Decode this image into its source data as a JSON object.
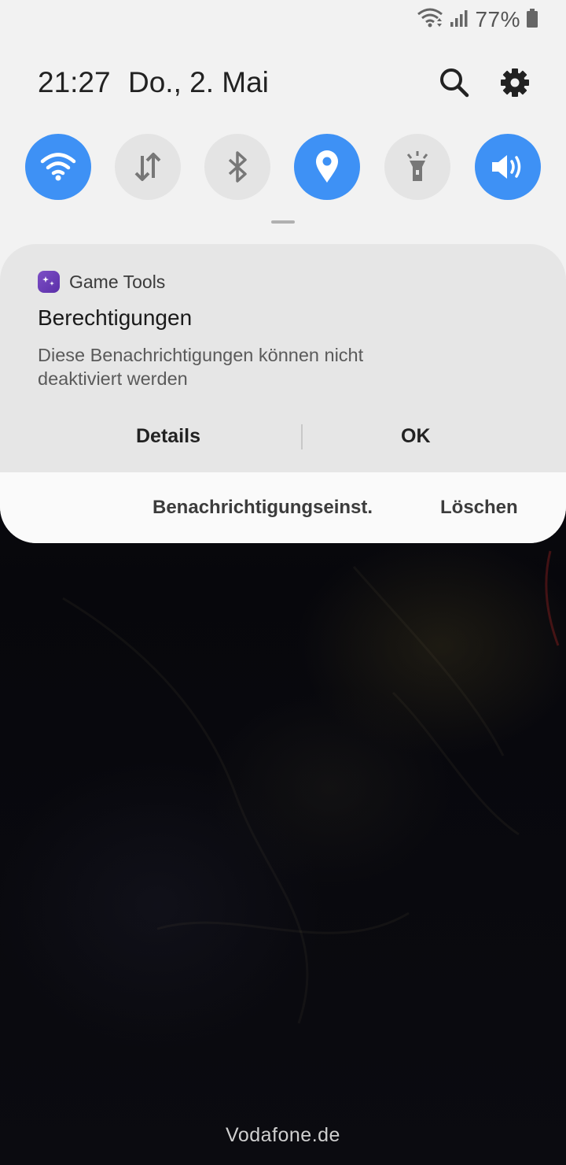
{
  "status_bar": {
    "battery_text": "77%"
  },
  "header": {
    "time": "21:27",
    "date": "Do., 2. Mai"
  },
  "quick_toggles": [
    {
      "name": "wifi",
      "icon": "wifi-icon",
      "active": true
    },
    {
      "name": "mobile-data",
      "icon": "data-arrows-icon",
      "active": false
    },
    {
      "name": "bluetooth",
      "icon": "bluetooth-icon",
      "active": false
    },
    {
      "name": "location",
      "icon": "location-pin-icon",
      "active": true
    },
    {
      "name": "flashlight",
      "icon": "flashlight-icon",
      "active": false
    },
    {
      "name": "sound",
      "icon": "speaker-icon",
      "active": true
    }
  ],
  "notification": {
    "app_name": "Game Tools",
    "title": "Berechtigungen",
    "body": "Diese Benachrichtigungen können nicht deaktiviert werden",
    "actions": {
      "details": "Details",
      "ok": "OK"
    }
  },
  "footer": {
    "settings_label": "Benachrichtigungseinst.",
    "clear_label": "Löschen"
  },
  "carrier": "Vodafone.de",
  "colors": {
    "accent": "#3e91f5",
    "panel": "#f2f2f2",
    "toggle_off": "#e4e4e4",
    "app_icon": "#6a3fb8"
  }
}
